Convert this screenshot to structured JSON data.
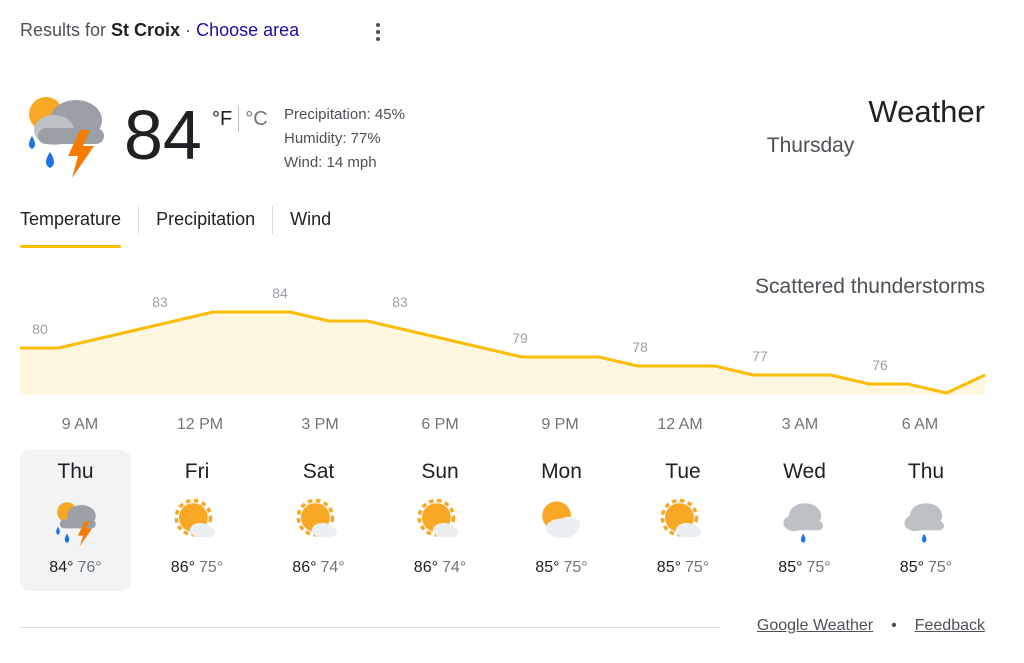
{
  "results": {
    "prefix": "Results for",
    "location": "St Croix",
    "separator": "·",
    "choose_area": "Choose area"
  },
  "current": {
    "temperature": "84",
    "unit_f": "°F",
    "unit_c": "°C",
    "precipitation": "Precipitation: 45%",
    "humidity": "Humidity: 77%",
    "wind": "Wind: 14 mph",
    "icon": "scattered-thunderstorms-icon"
  },
  "header": {
    "title": "Weather",
    "day": "Thursday",
    "condition": "Scattered thunderstorms"
  },
  "tabs": [
    {
      "label": "Temperature",
      "active": true
    },
    {
      "label": "Precipitation",
      "active": false
    },
    {
      "label": "Wind",
      "active": false
    }
  ],
  "chart_data": {
    "type": "area",
    "x_labels": [
      "9 AM",
      "12 PM",
      "3 PM",
      "6 PM",
      "9 PM",
      "12 AM",
      "3 AM",
      "6 AM"
    ],
    "labeled_values": [
      80,
      83,
      84,
      83,
      79,
      78,
      77,
      76
    ],
    "values": [
      80,
      80,
      81,
      82,
      83,
      84,
      84,
      84,
      83,
      83,
      82,
      81,
      80,
      79,
      79,
      79,
      78,
      78,
      78,
      77,
      77,
      77,
      76,
      76,
      75,
      77
    ],
    "ylim": [
      70,
      90
    ],
    "line_color": "#fbbc04",
    "fill_color": "#fef7e0"
  },
  "forecast": [
    {
      "day": "Thu",
      "high": "84°",
      "low": "76°",
      "icon": "scattered-thunderstorms-icon",
      "selected": true
    },
    {
      "day": "Fri",
      "high": "86°",
      "low": "75°",
      "icon": "partly-cloudy-icon",
      "selected": false
    },
    {
      "day": "Sat",
      "high": "86°",
      "low": "74°",
      "icon": "partly-cloudy-icon",
      "selected": false
    },
    {
      "day": "Sun",
      "high": "86°",
      "low": "74°",
      "icon": "partly-cloudy-icon",
      "selected": false
    },
    {
      "day": "Mon",
      "high": "85°",
      "low": "75°",
      "icon": "mostly-cloudy-icon",
      "selected": false
    },
    {
      "day": "Tue",
      "high": "85°",
      "low": "75°",
      "icon": "partly-cloudy-icon",
      "selected": false
    },
    {
      "day": "Wed",
      "high": "85°",
      "low": "75°",
      "icon": "showers-icon",
      "selected": false
    },
    {
      "day": "Thu",
      "high": "85°",
      "low": "75°",
      "icon": "showers-icon",
      "selected": false
    }
  ],
  "footer": {
    "source": "Google Weather",
    "dot": "•",
    "feedback": "Feedback"
  },
  "colors": {
    "accent": "#fbbc04",
    "link": "#1a0dab",
    "sun": "#f9a825",
    "rain": "#1a73e8",
    "bolt": "#f57c00"
  }
}
